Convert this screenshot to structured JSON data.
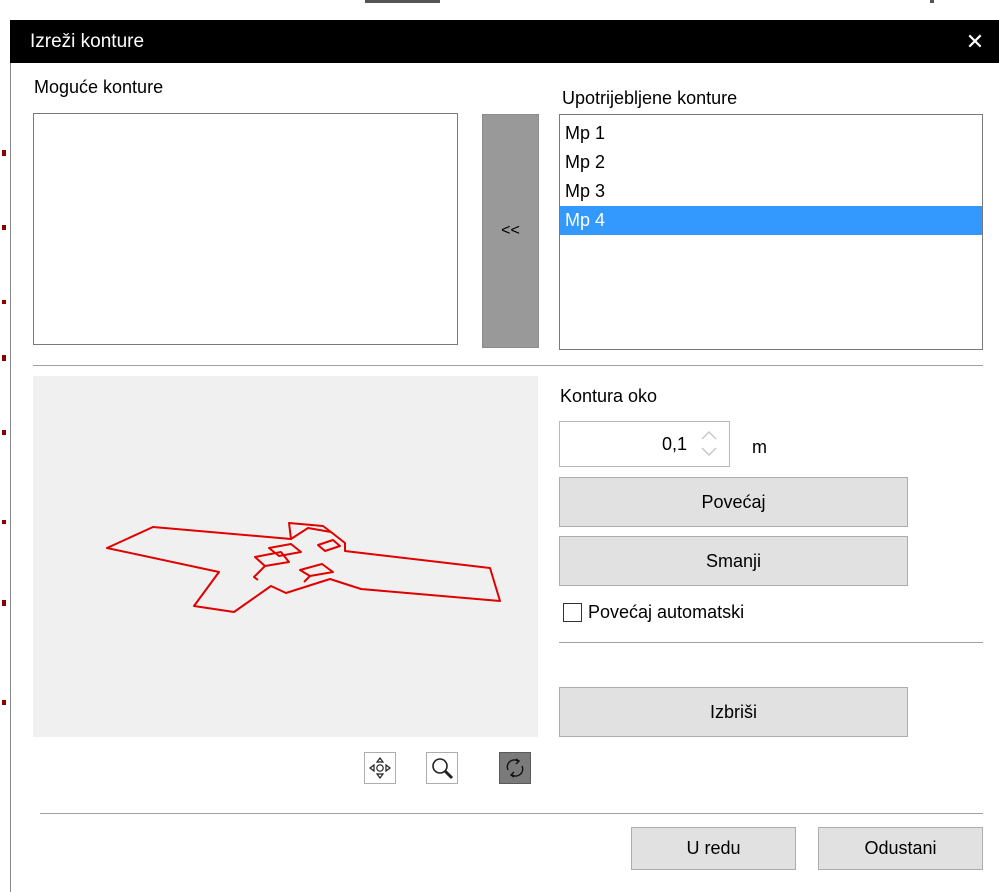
{
  "dialog": {
    "title": "Izreži konture",
    "close_glyph": "✕"
  },
  "available": {
    "label": "Moguće konture",
    "items": []
  },
  "transfer_button": {
    "label": "<<"
  },
  "used": {
    "label": "Upotrijebljene konture",
    "items": [
      {
        "label": "Mp 1",
        "selected": false
      },
      {
        "label": "Mp 2",
        "selected": false
      },
      {
        "label": "Mp 3",
        "selected": false
      },
      {
        "label": "Mp 4",
        "selected": true
      }
    ]
  },
  "contour": {
    "label": "Kontura oko",
    "value": "0,1",
    "unit": "m",
    "enlarge_label": "Povećaj",
    "shrink_label": "Smanji",
    "auto_enlarge_label": "Povećaj automatski",
    "auto_enlarge_checked": false,
    "delete_label": "Izbriši"
  },
  "preview": {
    "outline_color": "#e00000",
    "background": "#f0f0f0"
  },
  "view_tools": [
    {
      "icon": "pan-icon",
      "active": false
    },
    {
      "icon": "zoom-icon",
      "active": false
    },
    {
      "icon": "rotate-icon",
      "active": true
    }
  ],
  "footer": {
    "ok_label": "U redu",
    "cancel_label": "Odustani"
  },
  "colors": {
    "selection": "#3399ff",
    "titlebar": "#000000"
  }
}
